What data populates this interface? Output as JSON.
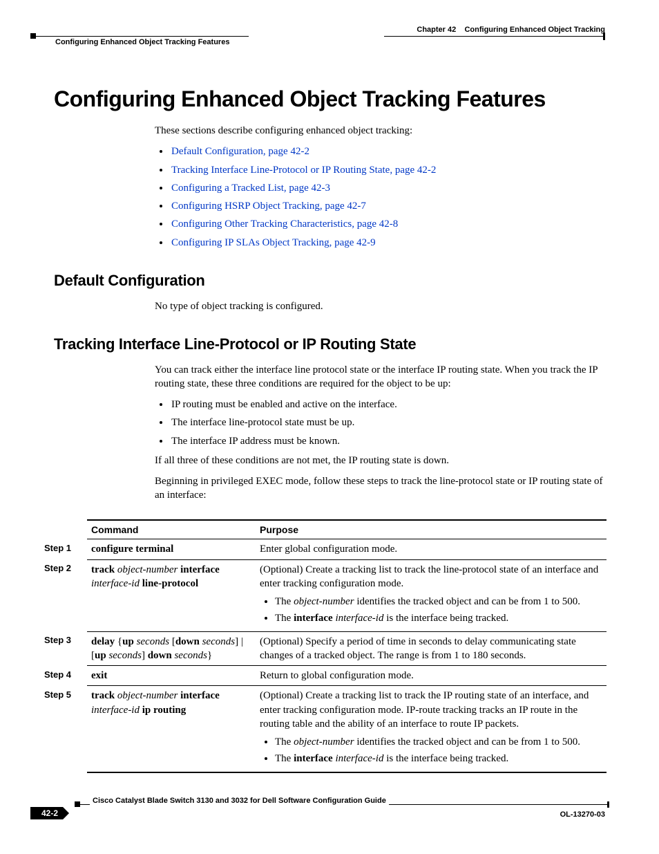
{
  "header": {
    "chapter_label": "Chapter 42",
    "chapter_title": "Configuring Enhanced Object Tracking",
    "running_head": "Configuring Enhanced Object Tracking Features"
  },
  "h1": "Configuring Enhanced Object Tracking Features",
  "intro": "These sections describe configuring enhanced object tracking:",
  "links": [
    "Default Configuration, page 42-2",
    "Tracking Interface Line-Protocol or IP Routing State, page 42-2",
    "Configuring a Tracked List, page 42-3",
    "Configuring HSRP Object Tracking, page 42-7",
    "Configuring Other Tracking Characteristics, page 42-8",
    "Configuring IP SLAs Object Tracking, page 42-9"
  ],
  "s1": {
    "title": "Default Configuration",
    "p1": "No type of object tracking is configured."
  },
  "s2": {
    "title": "Tracking Interface Line-Protocol or IP Routing State",
    "p1": "You can track either the interface line protocol state or the interface IP routing state. When you track the IP routing state, these three conditions are required for the object to be up:",
    "bullets": [
      "IP routing must be enabled and active on the interface.",
      "The interface line-protocol state must be up.",
      "The interface IP address must be known."
    ],
    "p2": "If all three of these conditions are not met, the IP routing state is down.",
    "p3": "Beginning in privileged EXEC mode, follow these steps to track the line-protocol state or IP routing state of an interface:"
  },
  "table": {
    "head_cmd": "Command",
    "head_purpose": "Purpose",
    "steps": {
      "s1": "Step 1",
      "s2": "Step 2",
      "s3": "Step 3",
      "s4": "Step 4",
      "s5": "Step 5"
    },
    "r1": {
      "cmd_b": "configure terminal",
      "purpose": "Enter global configuration mode."
    },
    "r2": {
      "cmd_pre_b": "track ",
      "cmd_obj_i": "object-number",
      "cmd_mid_b": " interface ",
      "cmd_if_i": "interface-id",
      "cmd_suf_b": " line-protocol",
      "purpose": "(Optional) Create a tracking list to track the line-protocol state of an interface and enter tracking configuration mode.",
      "li1_pre": "The ",
      "li1_i": "object-number",
      "li1_suf": " identifies the tracked object and can be from 1 to 500.",
      "li2_pre": "The ",
      "li2_b": "interface ",
      "li2_i": "interface-id",
      "li2_suf": " is the interface being tracked."
    },
    "r3": {
      "c_b1": "delay",
      "c_t1": " {",
      "c_b2": "up",
      "c_t2": " ",
      "c_i1": "seconds",
      "c_t3": " [",
      "c_b3": "down",
      "c_t4": " ",
      "c_i2": "seconds",
      "c_t5": "] | [",
      "c_b4": "up",
      "c_t6": " ",
      "c_i3": "seconds",
      "c_t7": "] ",
      "c_b5": "down",
      "c_t8": " ",
      "c_i4": "seconds",
      "c_t9": "}",
      "purpose": "(Optional) Specify a period of time in seconds to delay communicating state changes of a tracked object. The range is from 1 to 180 seconds."
    },
    "r4": {
      "cmd_b": "exit",
      "purpose": "Return to global configuration mode."
    },
    "r5": {
      "cmd_pre_b": "track ",
      "cmd_obj_i": "object-number",
      "cmd_mid_b": " interface ",
      "cmd_if_i": "interface-id",
      "cmd_suf_b": " ip routing",
      "purpose": "(Optional) Create a tracking list to track the IP routing state of an interface, and enter tracking configuration mode. IP-route tracking tracks an IP route in the routing table and the ability of an interface to route IP packets.",
      "li1_pre": "The ",
      "li1_i": "object-number",
      "li1_suf": " identifies the tracked object and can be from 1 to 500.",
      "li2_pre": "The ",
      "li2_b": "interface ",
      "li2_i": "interface-id",
      "li2_suf": " is the interface being tracked."
    }
  },
  "footer": {
    "book_title": "Cisco Catalyst Blade Switch 3130 and 3032 for Dell Software Configuration Guide",
    "page_number": "42-2",
    "doc_id": "OL-13270-03"
  }
}
